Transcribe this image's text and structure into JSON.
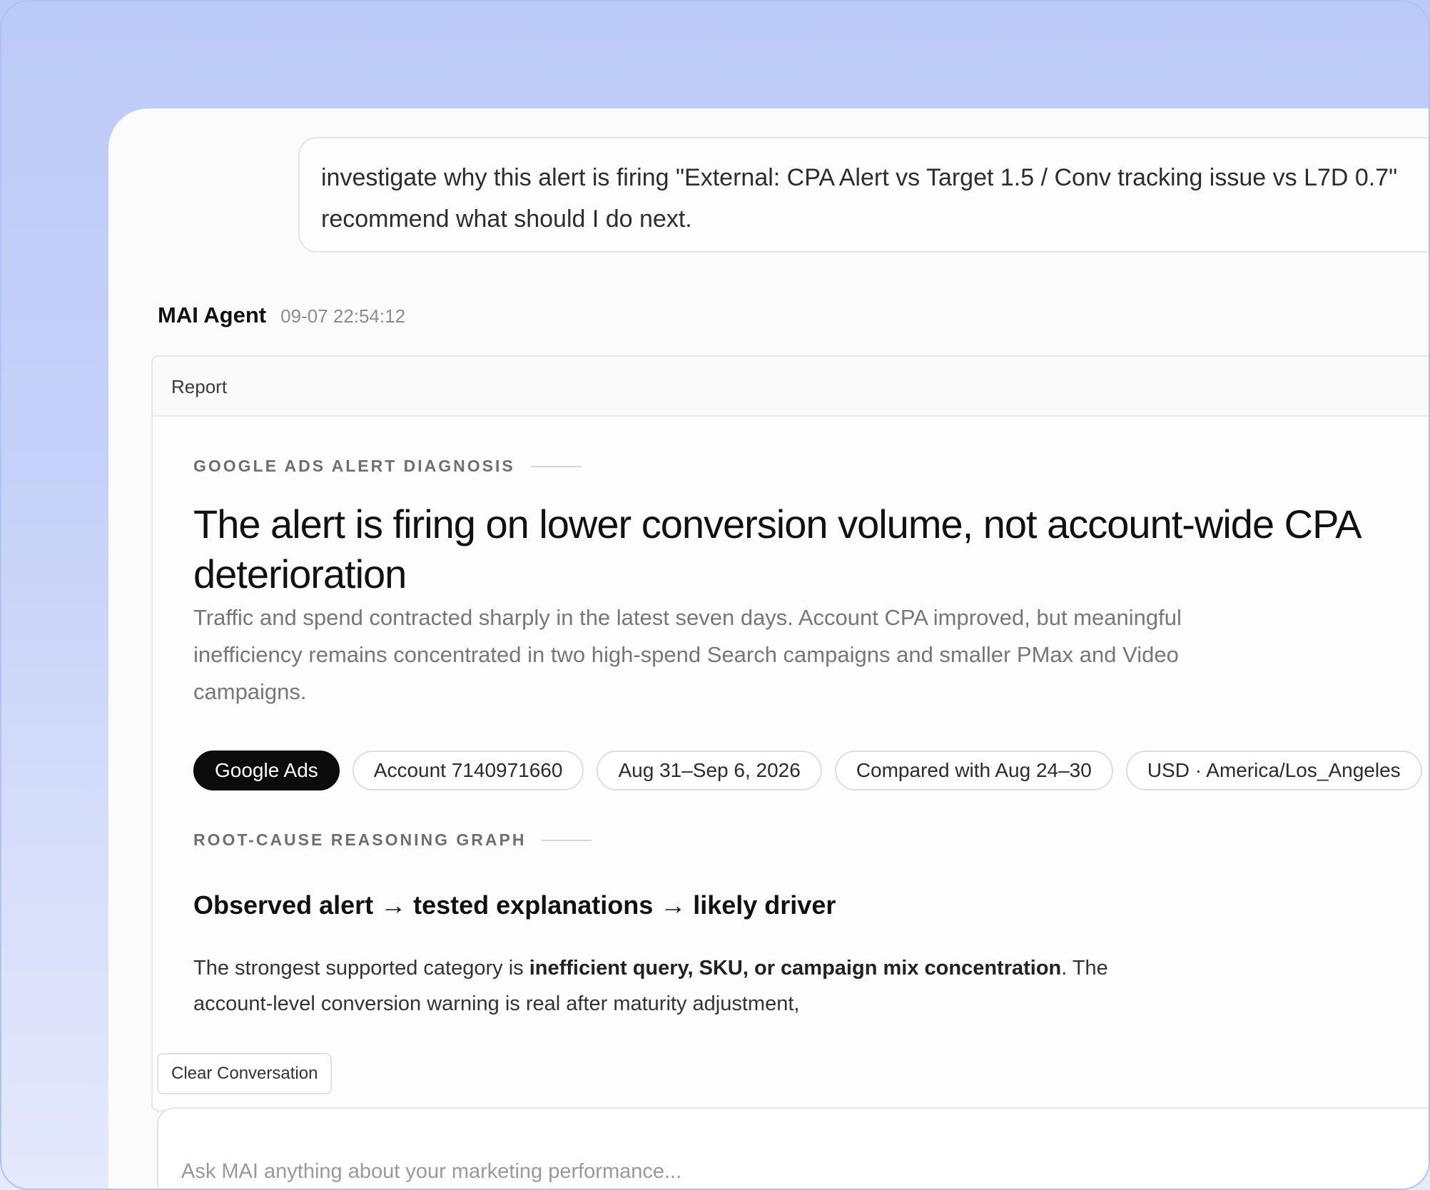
{
  "user_message": {
    "text": "investigate why this alert is firing \"External: CPA Alert vs Target 1.5 / Conv tracking issue vs L7D 0.7\"\nrecommend what should I do next."
  },
  "agent": {
    "name": "MAI Agent",
    "timestamp": "09-07 22:54:12"
  },
  "report": {
    "header": "Report",
    "eyebrow": "GOOGLE ADS ALERT DIAGNOSIS",
    "headline": "The alert is firing on lower conversion volume, not account-wide CPA deterioration",
    "subtext": "Traffic and spend contracted sharply in the latest seven days. Account CPA improved, but meaningful inefficiency remains concentrated in two high-spend Search campaigns and smaller PMax and Video campaigns.",
    "chips": [
      "Google Ads",
      "Account 7140971660",
      "Aug 31–Sep 6, 2026",
      "Compared with Aug 24–30",
      "USD · America/Los_Angeles"
    ],
    "graph_label": "ROOT-CAUSE REASONING GRAPH",
    "graph_title": "Observed alert → tested explanations → likely driver",
    "body_intro": "The strongest supported category is ",
    "body_bold": "inefficient query, SKU, or campaign mix concentration",
    "body_rest": ". The account-level conversion warning is real after maturity adjustment,"
  },
  "controls": {
    "clear_label": "Clear Conversation",
    "input_placeholder": "Ask MAI anything about your marketing performance..."
  }
}
